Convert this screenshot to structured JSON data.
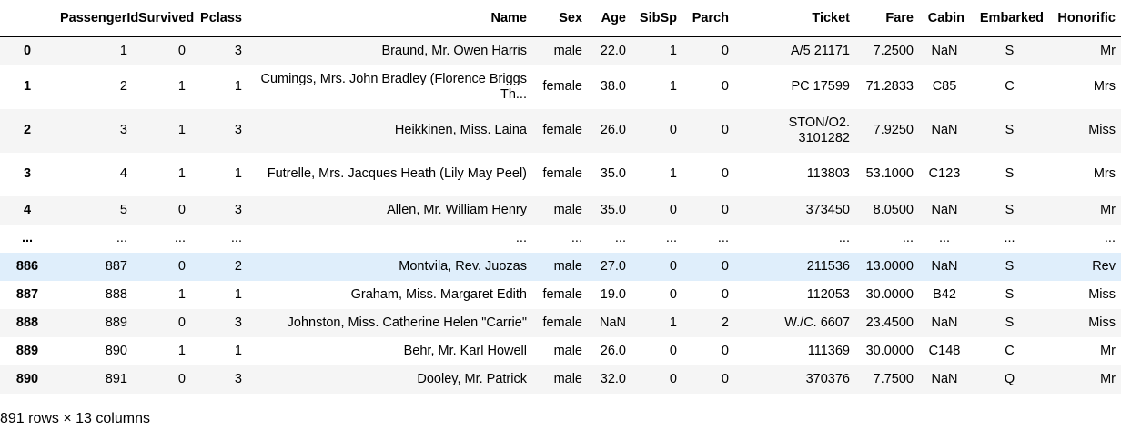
{
  "columns": [
    "",
    "PassengerId",
    "Survived",
    "Pclass",
    "Name",
    "Sex",
    "Age",
    "SibSp",
    "Parch",
    "Ticket",
    "Fare",
    "Cabin",
    "Embarked",
    "Honorific"
  ],
  "rows": [
    {
      "index": "0",
      "cells": [
        "1",
        "0",
        "3",
        "Braund, Mr. Owen Harris",
        "male",
        "22.0",
        "1",
        "0",
        "A/5 21171",
        "7.2500",
        "NaN",
        "S",
        "Mr"
      ]
    },
    {
      "index": "1",
      "cells": [
        "2",
        "1",
        "1",
        "Cumings, Mrs. John Bradley (Florence Briggs Th...",
        "female",
        "38.0",
        "1",
        "0",
        "PC 17599",
        "71.2833",
        "C85",
        "C",
        "Mrs"
      ]
    },
    {
      "index": "2",
      "cells": [
        "3",
        "1",
        "3",
        "Heikkinen, Miss. Laina",
        "female",
        "26.0",
        "0",
        "0",
        "STON/O2. 3101282",
        "7.9250",
        "NaN",
        "S",
        "Miss"
      ]
    },
    {
      "index": "3",
      "cells": [
        "4",
        "1",
        "1",
        "Futrelle, Mrs. Jacques Heath (Lily May Peel)",
        "female",
        "35.0",
        "1",
        "0",
        "113803",
        "53.1000",
        "C123",
        "S",
        "Mrs"
      ]
    },
    {
      "index": "4",
      "cells": [
        "5",
        "0",
        "3",
        "Allen, Mr. William Henry",
        "male",
        "35.0",
        "0",
        "0",
        "373450",
        "8.0500",
        "NaN",
        "S",
        "Mr"
      ]
    },
    {
      "index": "...",
      "cells": [
        "...",
        "...",
        "...",
        "...",
        "...",
        "...",
        "...",
        "...",
        "...",
        "...",
        "...",
        "...",
        "..."
      ]
    },
    {
      "index": "886",
      "cells": [
        "887",
        "0",
        "2",
        "Montvila, Rev. Juozas",
        "male",
        "27.0",
        "0",
        "0",
        "211536",
        "13.0000",
        "NaN",
        "S",
        "Rev"
      ]
    },
    {
      "index": "887",
      "cells": [
        "888",
        "1",
        "1",
        "Graham, Miss. Margaret Edith",
        "female",
        "19.0",
        "0",
        "0",
        "112053",
        "30.0000",
        "B42",
        "S",
        "Miss"
      ]
    },
    {
      "index": "888",
      "cells": [
        "889",
        "0",
        "3",
        "Johnston, Miss. Catherine Helen \"Carrie\"",
        "female",
        "NaN",
        "1",
        "2",
        "W./C. 6607",
        "23.4500",
        "NaN",
        "S",
        "Miss"
      ]
    },
    {
      "index": "889",
      "cells": [
        "890",
        "1",
        "1",
        "Behr, Mr. Karl Howell",
        "male",
        "26.0",
        "0",
        "0",
        "111369",
        "30.0000",
        "C148",
        "C",
        "Mr"
      ]
    },
    {
      "index": "890",
      "cells": [
        "891",
        "0",
        "3",
        "Dooley, Mr. Patrick",
        "male",
        "32.0",
        "0",
        "0",
        "370376",
        "7.7500",
        "NaN",
        "Q",
        "Mr"
      ]
    }
  ],
  "footer": "891 rows × 13 columns",
  "colors": {
    "stripe": "#f5f5f5",
    "hover_row": "#dfeefb",
    "header_rule": "#000000"
  }
}
